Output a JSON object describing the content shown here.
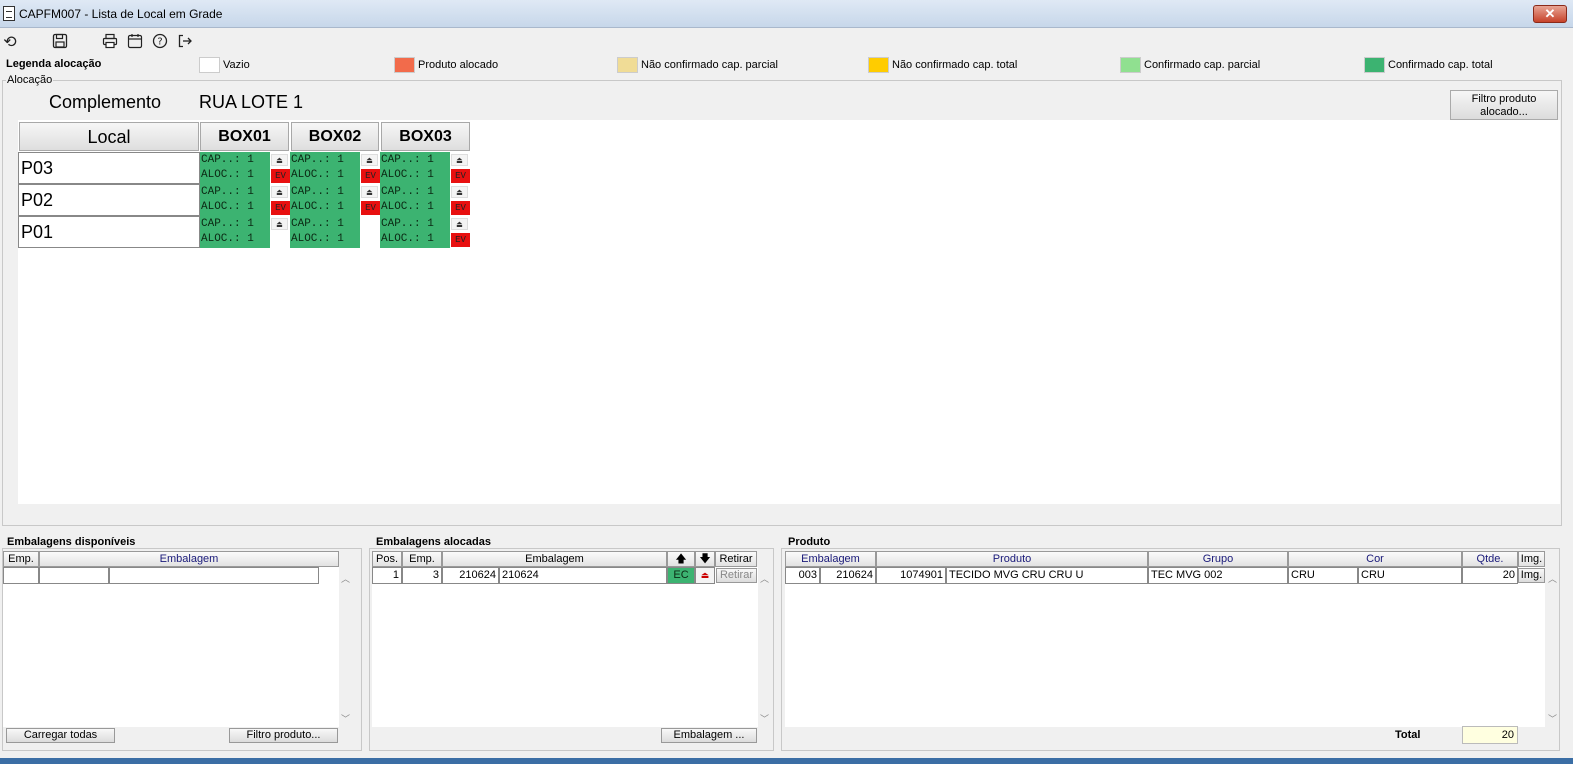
{
  "window": {
    "title": "CAPFM007 - Lista de Local em Grade",
    "close_label": "✕"
  },
  "toolbar": {
    "icons": [
      "undo-icon",
      "save-icon",
      "print-icon",
      "calendar-icon",
      "help-icon",
      "exit-icon"
    ]
  },
  "legend": {
    "title": "Legenda alocação",
    "items": [
      {
        "label": "Vazio",
        "color": "#ffffff"
      },
      {
        "label": "Produto alocado",
        "color": "#f26b4b"
      },
      {
        "label": "Não confirmado cap. parcial",
        "color": "#f0dc96"
      },
      {
        "label": "Não confirmado cap. total",
        "color": "#ffcc00"
      },
      {
        "label": "Confirmado cap. parcial",
        "color": "#90e090"
      },
      {
        "label": "Confirmado cap. total",
        "color": "#3cb371"
      }
    ]
  },
  "alocacao": {
    "group_label": "Alocação",
    "complemento_label": "Complemento",
    "complemento_value": "RUA LOTE 1",
    "filter_button": "Filtro produto alocado...",
    "grid": {
      "header_local": "Local",
      "columns": [
        "BOX01",
        "BOX02",
        "BOX03"
      ],
      "rows": [
        {
          "local": "P03",
          "cells": [
            {
              "cap": "CAP..: 1",
              "aloc": "ALOC.: 1",
              "ev": "EV"
            },
            {
              "cap": "CAP..: 1",
              "aloc": "ALOC.: 1",
              "ev": "EV"
            },
            {
              "cap": "CAP..: 1",
              "aloc": "ALOC.: 1",
              "ev": "EV"
            }
          ]
        },
        {
          "local": "P02",
          "cells": [
            {
              "cap": "CAP..: 1",
              "aloc": "ALOC.: 1",
              "ev": "EV"
            },
            {
              "cap": "CAP..: 1",
              "aloc": "ALOC.: 1",
              "ev": "EV"
            },
            {
              "cap": "CAP..: 1",
              "aloc": "ALOC.: 1",
              "ev": "EV"
            }
          ]
        },
        {
          "local": "P01",
          "cells": [
            {
              "cap": "CAP..: 1",
              "aloc": "ALOC.: 1",
              "ev": ""
            },
            {
              "cap": "CAP..: 1",
              "aloc": "ALOC.: 1",
              "ev": ""
            },
            {
              "cap": "CAP..: 1",
              "aloc": "ALOC.: 1",
              "ev": "EV"
            }
          ]
        }
      ]
    }
  },
  "disponiveis": {
    "group_label": "Embalagens disponíveis",
    "headers": [
      "Emp.",
      "Embalagem"
    ],
    "btn_carregar": "Carregar todas",
    "btn_filtro": "Filtro produto..."
  },
  "alocadas": {
    "group_label": "Embalagens alocadas",
    "headers": [
      "Pos.",
      "Emp.",
      "Embalagem",
      "🡅",
      "🡇",
      "Retirar"
    ],
    "rows": [
      {
        "pos": "1",
        "emp": "3",
        "emb1": "210624",
        "emb2": "210624",
        "status": "EC",
        "retirar": "Retirar"
      }
    ],
    "btn_embalagem": "Embalagem ..."
  },
  "produto": {
    "group_label": "Produto",
    "headers": [
      "Embalagem",
      "Produto",
      "Grupo",
      "Cor",
      "Qtde.",
      "Img."
    ],
    "rows": [
      {
        "emb1": "003",
        "emb2": "210624",
        "cod": "1074901",
        "produto": "TECIDO MVG CRU CRU U",
        "grupo": "TEC MVG 002",
        "cor1": "CRU",
        "cor2": "CRU",
        "qtde": "20",
        "img": "Img."
      }
    ],
    "total_label": "Total",
    "total_value": "20"
  }
}
